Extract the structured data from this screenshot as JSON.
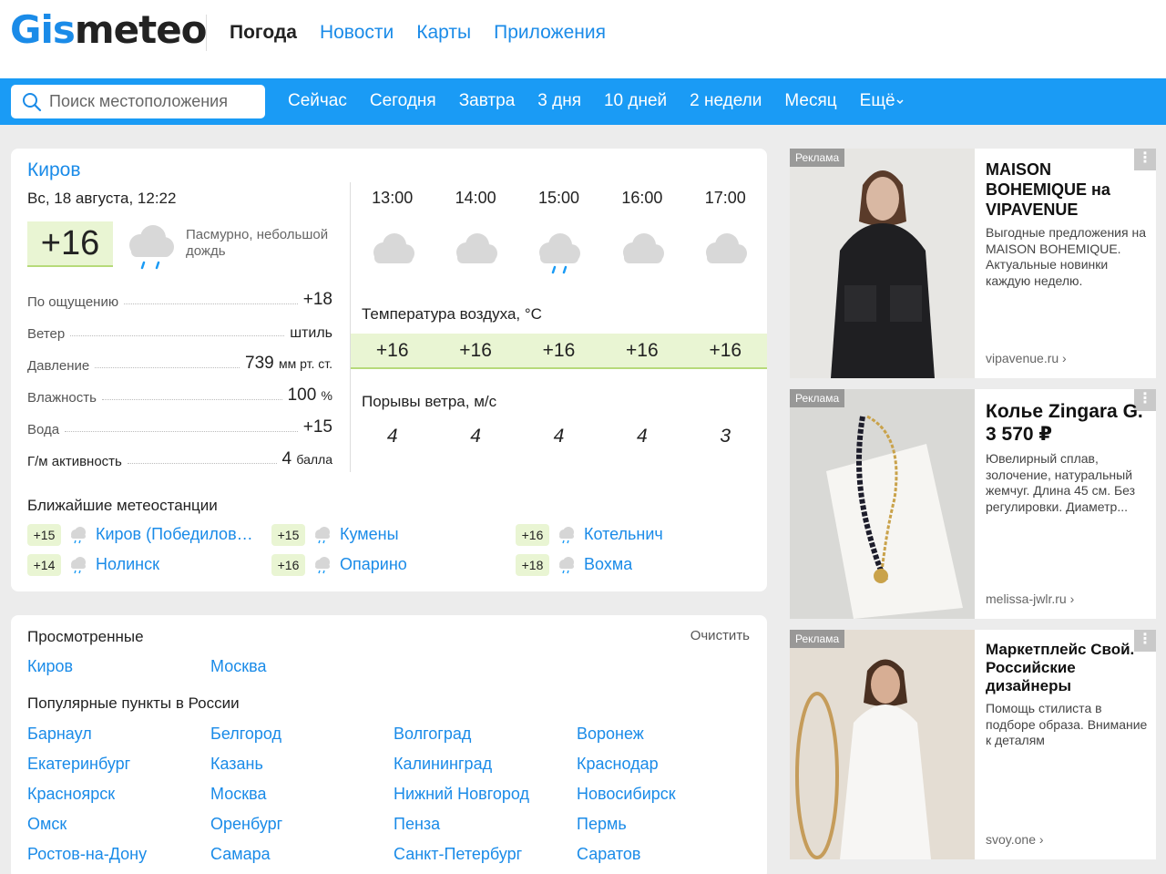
{
  "header": {
    "logo_part1": "Gis",
    "logo_part2": "meteo",
    "nav": [
      "Погода",
      "Новости",
      "Карты",
      "Приложения"
    ]
  },
  "toolbar": {
    "search_placeholder": "Поиск местоположения",
    "periods": [
      "Сейчас",
      "Сегодня",
      "Завтра",
      "3 дня",
      "10 дней",
      "2 недели",
      "Месяц",
      "Ещё"
    ]
  },
  "current": {
    "city": "Киров",
    "date": "Вс, 18 августа, 12:22",
    "temp": "+16",
    "condition": "Пасмурно, небольшой дождь",
    "params": [
      {
        "label": "По ощущению",
        "value": "+18",
        "unit": ""
      },
      {
        "label": "Ветер",
        "value": "штиль",
        "unit": ""
      },
      {
        "label": "Давление",
        "value": "739",
        "unit": "мм рт. ст."
      },
      {
        "label": "Влажность",
        "value": "100",
        "unit": "%"
      },
      {
        "label": "Вода",
        "value": "+15",
        "unit": ""
      },
      {
        "label": "Г/м активность",
        "value": "4",
        "unit": "балла"
      }
    ]
  },
  "hourly": {
    "hours": [
      "13:00",
      "14:00",
      "15:00",
      "16:00",
      "17:00"
    ],
    "icons": [
      "cloud-icon",
      "cloud-icon",
      "cloud-rain-icon",
      "cloud-icon",
      "cloud-icon"
    ],
    "temp_label": "Температура воздуха, °C",
    "temps": [
      "+16",
      "+16",
      "+16",
      "+16",
      "+16"
    ],
    "gust_label": "Порывы ветра, м/с",
    "gusts": [
      "4",
      "4",
      "4",
      "4",
      "3"
    ]
  },
  "stations": {
    "title": "Ближайшие метеостанции",
    "items": [
      {
        "temp": "+15",
        "name": "Киров (Победилов…"
      },
      {
        "temp": "+15",
        "name": "Кумены"
      },
      {
        "temp": "+16",
        "name": "Котельнич"
      },
      {
        "temp": "+14",
        "name": "Нолинск"
      },
      {
        "temp": "+16",
        "name": "Опарино"
      },
      {
        "temp": "+18",
        "name": "Вохма"
      }
    ]
  },
  "viewed": {
    "title": "Просмотренные",
    "clear_label": "Очистить",
    "items": [
      "Киров",
      "Москва"
    ]
  },
  "popular": {
    "title": "Популярные пункты в России",
    "items": [
      "Барнаул",
      "Белгород",
      "Волгоград",
      "Воронеж",
      "Екатеринбург",
      "Казань",
      "Калининград",
      "Краснодар",
      "Красноярск",
      "Москва",
      "Нижний Новгород",
      "Новосибирск",
      "Омск",
      "Оренбург",
      "Пенза",
      "Пермь",
      "Ростов-на-Дону",
      "Самара",
      "Санкт-Петербург",
      "Саратов"
    ]
  },
  "ads": [
    {
      "tag": "Реклама",
      "title": "MAISON BOHEMIQUE на VIPAVENUE",
      "text": "Выгодные предложения на MAISON BOHEMIQUE. Актуальные новинки каждую неделю.",
      "site": "vipavenue.ru"
    },
    {
      "tag": "Реклама",
      "title": "Колье Zingara G. 3 570 ₽",
      "text": "Ювелирный сплав, золочение, натуральный жемчуг. Длина 45 см. Без регулировки. Диаметр...",
      "site": "melissa-jwlr.ru"
    },
    {
      "tag": "Реклама",
      "title": "Маркетплейс Свой. Российские дизайнеры",
      "text": "Помощь стилиста в подборе образа. Внимание к деталям",
      "site": "svoy.one"
    }
  ],
  "colors": {
    "accent": "#1a8be8",
    "bar": "#1a9bf5",
    "temp_bg": "#e9f5d3"
  }
}
